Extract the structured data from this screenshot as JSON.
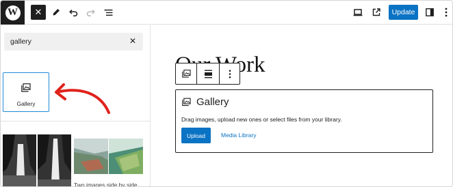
{
  "topbar": {
    "logo_letter": "W",
    "close_icon": "close-icon",
    "tools_icon": "pencil-icon",
    "undo_icon": "undo-icon",
    "redo_icon": "redo-icon",
    "list_view_icon": "list-view-icon",
    "preview_icon": "desktop-icon",
    "view_post_icon": "external-link-icon",
    "update_label": "Update",
    "settings_icon": "sidebar-icon",
    "options_icon": "more-vertical-icon",
    "accent_color": "#0b73c4"
  },
  "inserter": {
    "search_value": "gallery",
    "clear_icon": "close-icon",
    "results": [
      {
        "label": "Gallery",
        "icon": "gallery-icon"
      }
    ],
    "pattern_caption": "Two images side by side",
    "highlight_color": "#e0221b"
  },
  "canvas": {
    "heading": "Our Work",
    "block_toolbar": [
      "gallery-icon",
      "align-icon",
      "more-vertical-icon"
    ],
    "gallery_block": {
      "title": "Gallery",
      "instructions": "Drag images, upload new ones or select files from your library.",
      "upload_label": "Upload",
      "media_library_label": "Media Library"
    }
  }
}
